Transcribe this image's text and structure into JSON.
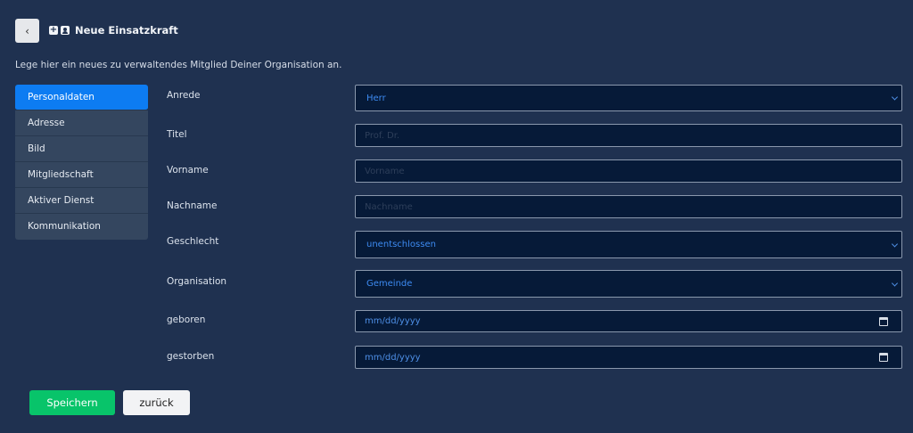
{
  "header": {
    "back_icon": "chevron-left-icon",
    "back_glyph": "‹",
    "plus_glyph": "+",
    "title": "Neue Einsatzkraft"
  },
  "intro_text": "Lege hier ein neues zu verwaltendes Mitglied Deiner Organisation an.",
  "sidebar": {
    "items": [
      {
        "label": "Personaldaten",
        "active": true
      },
      {
        "label": "Adresse"
      },
      {
        "label": "Bild"
      },
      {
        "label": "Mitgliedschaft"
      },
      {
        "label": "Aktiver Dienst"
      },
      {
        "label": "Kommunikation"
      }
    ]
  },
  "form": {
    "anrede": {
      "label": "Anrede",
      "value": "Herr"
    },
    "titel": {
      "label": "Titel",
      "placeholder": "Prof. Dr."
    },
    "vorname": {
      "label": "Vorname",
      "placeholder": "Vorname"
    },
    "nachname": {
      "label": "Nachname",
      "placeholder": "Nachname"
    },
    "geschlecht": {
      "label": "Geschlecht",
      "value": "unentschlossen"
    },
    "organisation": {
      "label": "Organisation",
      "value": "Gemeinde"
    },
    "geboren": {
      "label": "geboren",
      "value": "mm/dd/yyyy"
    },
    "gestorben": {
      "label": "gestorben",
      "value": "mm/dd/yyyy"
    }
  },
  "buttons": {
    "save": "Speichern",
    "back": "zurück"
  },
  "colors": {
    "background": "#1f3150",
    "active_nav": "#0d7cf2",
    "save_button": "#08c46a",
    "field_bg": "#061a38"
  }
}
